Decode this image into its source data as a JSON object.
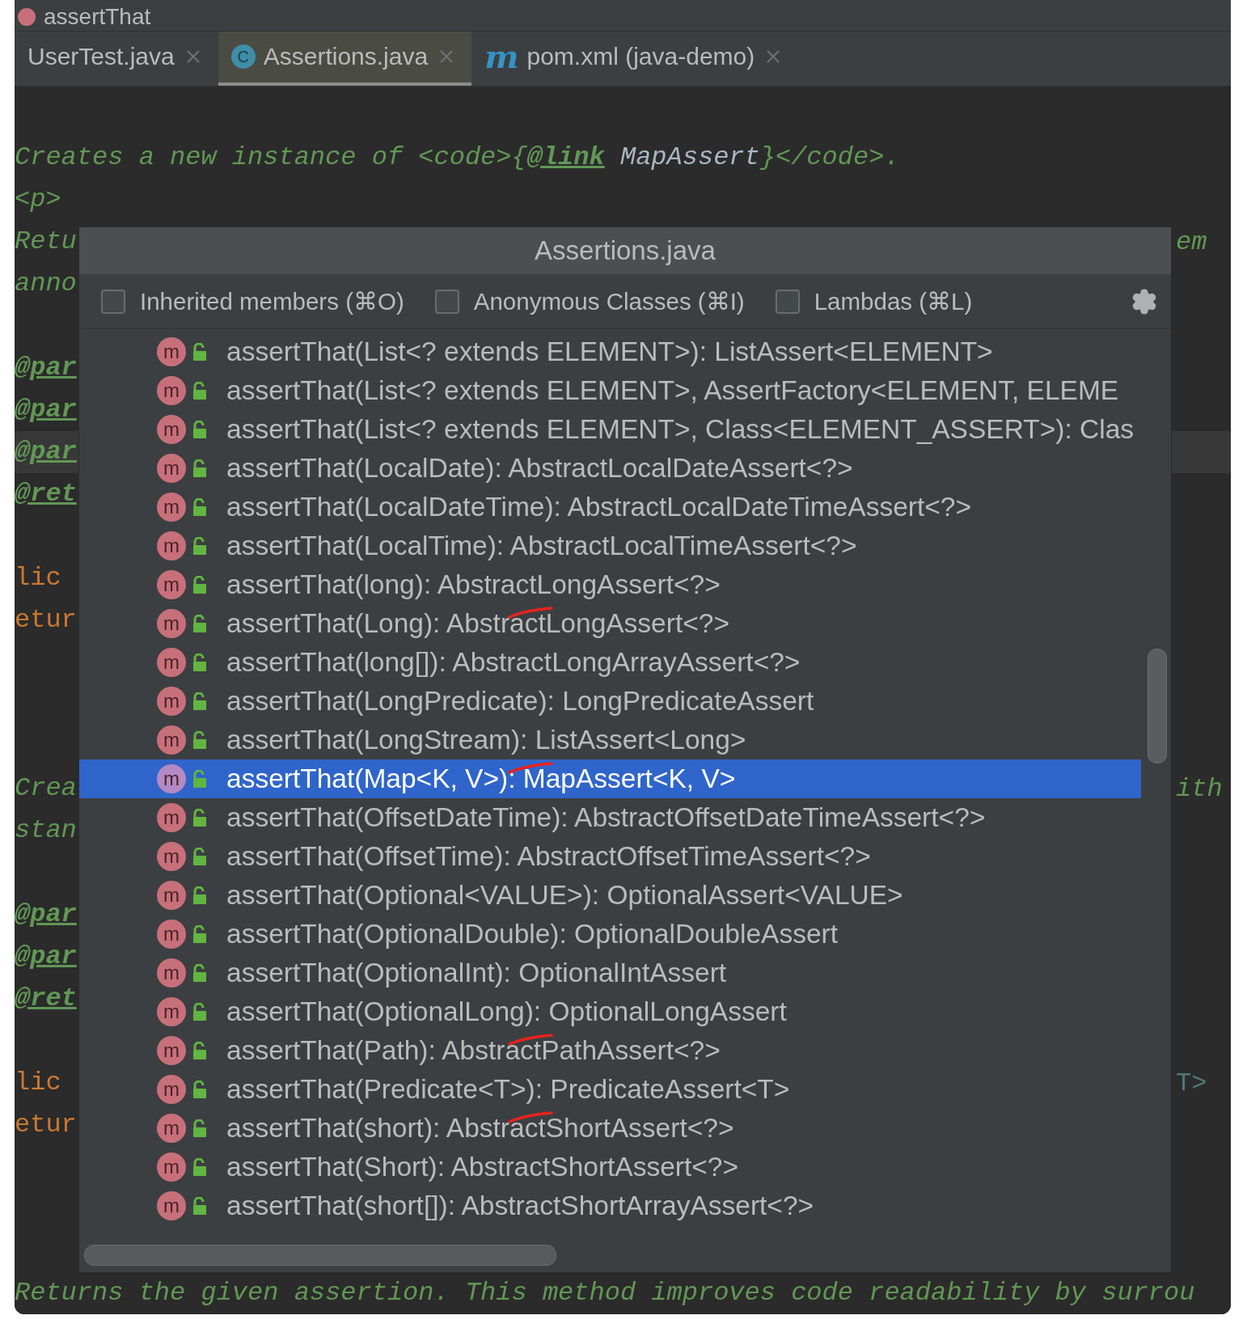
{
  "title_bar": {
    "title": "assertThat"
  },
  "tabs": [
    {
      "label": "UserTest.java",
      "kind": "test",
      "selected": false
    },
    {
      "label": "Assertions.java",
      "kind": "class",
      "icon_letter": "C",
      "selected": true
    },
    {
      "label": "pom.xml (java-demo)",
      "kind": "maven",
      "icon_letter": "m",
      "selected": false
    }
  ],
  "editor": {
    "blocks": [
      {
        "kind": "comment",
        "lines": [
          {
            "current": false,
            "segments": [
              {
                "text": "Creates a new instance of <code>{",
                "kind": "comment"
              },
              {
                "text": "@link",
                "kind": "tag"
              },
              {
                "text": " MapAssert",
                "kind": "ref"
              },
              {
                "text": "}</code>.",
                "kind": "comment"
              }
            ]
          },
          {
            "current": false,
            "segments": [
              {
                "text": "<p>",
                "kind": "comment"
              }
            ]
          },
          {
            "current": false,
            "segments": [
              {
                "text": "Retu",
                "kind": "comment"
              }
            ],
            "right": {
              "text": "em",
              "kind": "comment"
            }
          },
          {
            "current": false,
            "segments": [
              {
                "text": "anno",
                "kind": "comment"
              }
            ]
          }
        ]
      },
      {
        "kind": "comment",
        "lines": [
          {
            "current": false,
            "segments": [
              {
                "text": "@par",
                "kind": "tag"
              }
            ]
          },
          {
            "current": false,
            "segments": [
              {
                "text": "@par",
                "kind": "tag"
              }
            ]
          },
          {
            "current": true,
            "segments": [
              {
                "text": "@par",
                "kind": "tag"
              }
            ]
          },
          {
            "current": false,
            "segments": [
              {
                "text": "@ret",
                "kind": "tag"
              }
            ]
          }
        ]
      },
      {
        "kind": "code",
        "lines": [
          {
            "current": false,
            "segments": [
              {
                "text": "lic",
                "kind": "keyword"
              }
            ]
          },
          {
            "current": false,
            "segments": [
              {
                "text": "etur",
                "kind": "keyword"
              }
            ]
          }
        ]
      },
      {
        "kind": "comment",
        "lines": [
          {
            "current": false,
            "segments": [
              {
                "text": "Crea",
                "kind": "comment"
              }
            ],
            "right": {
              "text": "ith",
              "kind": "comment"
            }
          },
          {
            "current": false,
            "segments": [
              {
                "text": "stan",
                "kind": "comment"
              }
            ]
          }
        ]
      },
      {
        "kind": "comment",
        "lines": [
          {
            "current": false,
            "segments": [
              {
                "text": "@par",
                "kind": "tag"
              }
            ]
          },
          {
            "current": false,
            "segments": [
              {
                "text": "@par",
                "kind": "tag"
              }
            ]
          },
          {
            "current": false,
            "segments": [
              {
                "text": "@ret",
                "kind": "tag"
              }
            ]
          }
        ]
      },
      {
        "kind": "code",
        "lines": [
          {
            "current": false,
            "segments": [
              {
                "text": "lic",
                "kind": "keyword"
              }
            ],
            "right": {
              "text": "T>",
              "kind": "type"
            }
          },
          {
            "current": false,
            "segments": [
              {
                "text": "etur",
                "kind": "keyword"
              }
            ]
          }
        ]
      },
      {
        "kind": "comment",
        "lines": [
          {
            "current": false,
            "segments": [
              {
                "text": "Returns the given assertion. This method improves code readability by surrou",
                "kind": "comment"
              }
            ]
          }
        ]
      }
    ]
  },
  "popup": {
    "title": "Assertions.java",
    "filters": [
      {
        "label": "Inherited members (⌘O)",
        "checked": false
      },
      {
        "label": "Anonymous Classes (⌘I)",
        "checked": false
      },
      {
        "label": "Lambdas (⌘L)",
        "checked": false
      }
    ],
    "items": [
      {
        "badge": "m",
        "signature": "assertThat(List<? extends ELEMENT>): ListAssert<ELEMENT>",
        "selected": false,
        "marked": false
      },
      {
        "badge": "m",
        "signature": "assertThat(List<? extends ELEMENT>, AssertFactory<ELEMENT, ELEME",
        "selected": false,
        "marked": false
      },
      {
        "badge": "m",
        "signature": "assertThat(List<? extends ELEMENT>, Class<ELEMENT_ASSERT>): Clas",
        "selected": false,
        "marked": false
      },
      {
        "badge": "m",
        "signature": "assertThat(LocalDate): AbstractLocalDateAssert<?>",
        "selected": false,
        "marked": false
      },
      {
        "badge": "m",
        "signature": "assertThat(LocalDateTime): AbstractLocalDateTimeAssert<?>",
        "selected": false,
        "marked": false
      },
      {
        "badge": "m",
        "signature": "assertThat(LocalTime): AbstractLocalTimeAssert<?>",
        "selected": false,
        "marked": false
      },
      {
        "badge": "m",
        "signature": "assertThat(long): AbstractLongAssert<?>",
        "selected": false,
        "marked": false
      },
      {
        "badge": "m",
        "signature": "assertThat(Long): AbstractLongAssert<?>",
        "selected": false,
        "marked": true
      },
      {
        "badge": "m",
        "signature": "assertThat(long[]): AbstractLongArrayAssert<?>",
        "selected": false,
        "marked": false
      },
      {
        "badge": "m",
        "signature": "assertThat(LongPredicate): LongPredicateAssert",
        "selected": false,
        "marked": false
      },
      {
        "badge": "m",
        "signature": "assertThat(LongStream): ListAssert<Long>",
        "selected": false,
        "marked": false
      },
      {
        "badge": "m",
        "signature": "assertThat(Map<K, V>): MapAssert<K, V>",
        "selected": true,
        "marked": true
      },
      {
        "badge": "m",
        "signature": "assertThat(OffsetDateTime): AbstractOffsetDateTimeAssert<?>",
        "selected": false,
        "marked": false
      },
      {
        "badge": "m",
        "signature": "assertThat(OffsetTime): AbstractOffsetTimeAssert<?>",
        "selected": false,
        "marked": false
      },
      {
        "badge": "m",
        "signature": "assertThat(Optional<VALUE>): OptionalAssert<VALUE>",
        "selected": false,
        "marked": false
      },
      {
        "badge": "m",
        "signature": "assertThat(OptionalDouble): OptionalDoubleAssert",
        "selected": false,
        "marked": false
      },
      {
        "badge": "m",
        "signature": "assertThat(OptionalInt): OptionalIntAssert",
        "selected": false,
        "marked": false
      },
      {
        "badge": "m",
        "signature": "assertThat(OptionalLong): OptionalLongAssert",
        "selected": false,
        "marked": false
      },
      {
        "badge": "m",
        "signature": "assertThat(Path): AbstractPathAssert<?>",
        "selected": false,
        "marked": true
      },
      {
        "badge": "m",
        "signature": "assertThat(Predicate<T>): PredicateAssert<T>",
        "selected": false,
        "marked": false
      },
      {
        "badge": "m",
        "signature": "assertThat(short): AbstractShortAssert<?>",
        "selected": false,
        "marked": true
      },
      {
        "badge": "m",
        "signature": "assertThat(Short): AbstractShortAssert<?>",
        "selected": false,
        "marked": false
      },
      {
        "badge": "m",
        "signature": "assertThat(short[]): AbstractShortArrayAssert<?>",
        "selected": false,
        "marked": false
      }
    ]
  }
}
